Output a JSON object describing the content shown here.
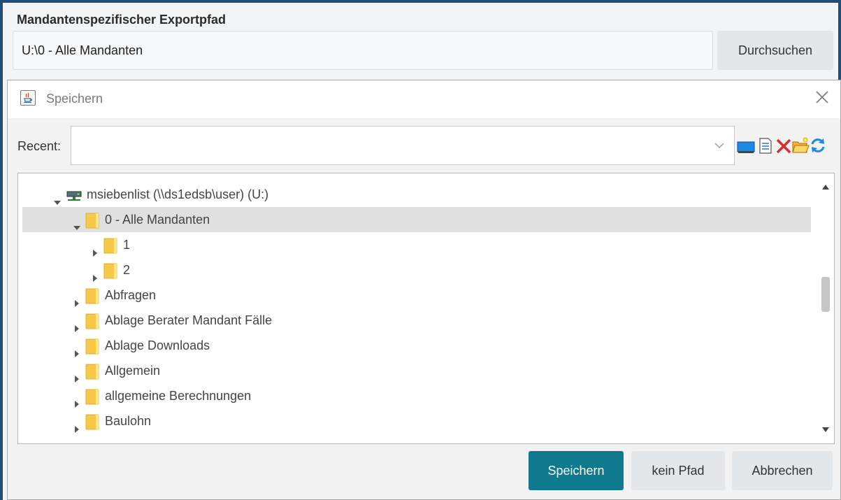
{
  "export_path": {
    "label": "Mandantenspezifischer Exportpfad",
    "value": "U:\\0 - Alle Mandanten",
    "browse_label": "Durchsuchen"
  },
  "dialog": {
    "title": "Speichern",
    "recent_label": "Recent:",
    "recent_value": "",
    "toolbar_icons": [
      "desktop-icon",
      "document-details-icon",
      "delete-icon",
      "new-folder-icon",
      "refresh-icon"
    ],
    "tree": [
      {
        "label": "msiebenlist (\\\\ds1edsb\\user) (U:)",
        "type": "drive",
        "level": 0,
        "expanded": true,
        "selected": false
      },
      {
        "label": "0 - Alle Mandanten",
        "type": "folder",
        "level": 1,
        "expanded": true,
        "selected": true
      },
      {
        "label": "1",
        "type": "folder",
        "level": 2,
        "expanded": false,
        "selected": false
      },
      {
        "label": "2",
        "type": "folder",
        "level": 2,
        "expanded": false,
        "selected": false
      },
      {
        "label": "Abfragen",
        "type": "folder",
        "level": 1,
        "expanded": false,
        "selected": false
      },
      {
        "label": "Ablage Berater Mandant Fälle",
        "type": "folder",
        "level": 1,
        "expanded": false,
        "selected": false
      },
      {
        "label": "Ablage Downloads",
        "type": "folder",
        "level": 1,
        "expanded": false,
        "selected": false
      },
      {
        "label": "Allgemein",
        "type": "folder",
        "level": 1,
        "expanded": false,
        "selected": false
      },
      {
        "label": "allgemeine Berechnungen",
        "type": "folder",
        "level": 1,
        "expanded": false,
        "selected": false
      },
      {
        "label": "Baulohn",
        "type": "folder",
        "level": 1,
        "expanded": false,
        "selected": false
      }
    ],
    "buttons": {
      "save": "Speichern",
      "no_path": "kein Pfad",
      "cancel": "Abbrechen"
    }
  },
  "colors": {
    "frame": "#1f4e79",
    "primary_button": "#0f7a8e",
    "secondary_button": "#e3e7ea",
    "selection": "#e0e0e0",
    "folder": "#f7c948"
  }
}
